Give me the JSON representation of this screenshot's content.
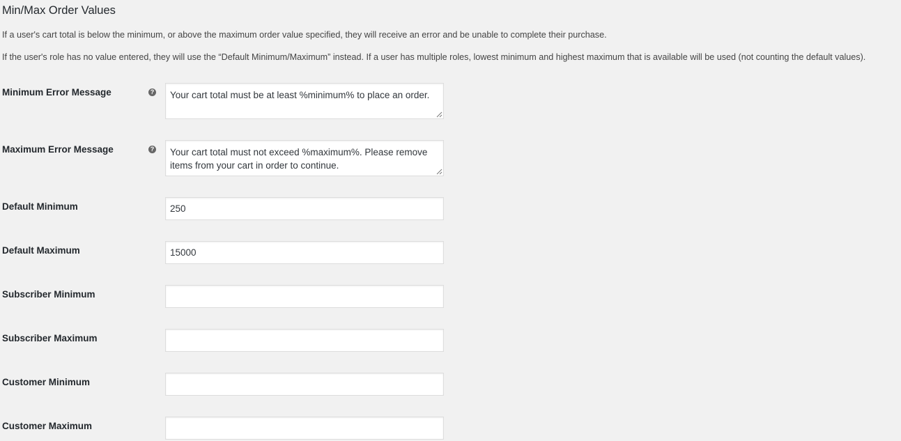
{
  "section": {
    "title": "Min/Max Order Values",
    "description_1": "If a user's cart total is below the minimum, or above the maximum order value specified, they will receive an error and be unable to complete their purchase.",
    "description_2": "If the user's role has no value entered, they will use the “Default Minimum/Maximum” instead. If a user has multiple roles, lowest minimum and highest maximum that is available will be used (not counting the default values)."
  },
  "fields": {
    "min_error": {
      "label": "Minimum Error Message",
      "help_icon": "?",
      "value": "Your cart total must be at least %minimum% to place an order."
    },
    "max_error": {
      "label": "Maximum Error Message",
      "help_icon": "?",
      "value": "Your cart total must not exceed %maximum%. Please remove items from your cart in order to continue."
    },
    "default_min": {
      "label": "Default Minimum",
      "value": "250"
    },
    "default_max": {
      "label": "Default Maximum",
      "value": "15000"
    },
    "subscriber_min": {
      "label": "Subscriber Minimum",
      "value": ""
    },
    "subscriber_max": {
      "label": "Subscriber Maximum",
      "value": ""
    },
    "customer_min": {
      "label": "Customer Minimum",
      "value": ""
    },
    "customer_max": {
      "label": "Customer Maximum",
      "value": ""
    }
  }
}
